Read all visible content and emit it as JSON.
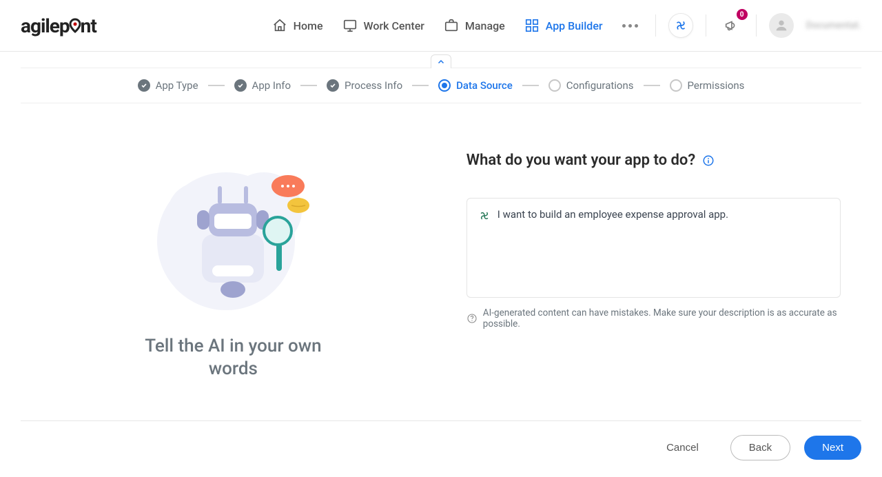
{
  "brand": "agilepoint",
  "nav": {
    "home": "Home",
    "work_center": "Work Center",
    "manage": "Manage",
    "app_builder": "App Builder"
  },
  "notif_count": "0",
  "user_name": "Documentat.",
  "steps": {
    "app_type": "App Type",
    "app_info": "App Info",
    "process_info": "Process Info",
    "data_source": "Data Source",
    "configurations": "Configurations",
    "permissions": "Permissions"
  },
  "left": {
    "tagline": "Tell the AI in your own words"
  },
  "right": {
    "heading": "What do you want your app to do?",
    "input_text": "I want to build an employee expense approval app.",
    "disclaimer": "AI-generated content can have mistakes. Make sure your description is as accurate as possible."
  },
  "footer": {
    "cancel": "Cancel",
    "back": "Back",
    "next": "Next"
  }
}
